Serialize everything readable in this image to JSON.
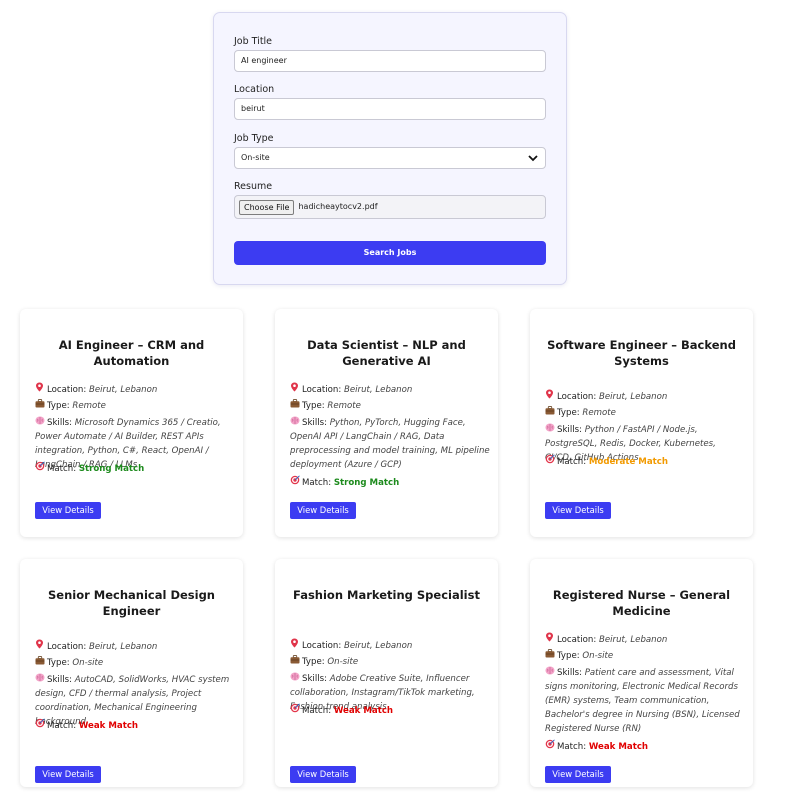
{
  "form": {
    "job_title_label": "Job Title",
    "job_title_value": "AI engineer",
    "location_label": "Location",
    "location_value": "beirut",
    "job_type_label": "Job Type",
    "job_type_value": "On-site",
    "resume_label": "Resume",
    "choose_file_label": "Choose File",
    "resume_file": "hadicheaytocv2.pdf",
    "search_label": "Search Jobs"
  },
  "labels": {
    "location": "Location:",
    "type": "Type:",
    "skills": "Skills:",
    "match": "Match:",
    "view_details": "View Details"
  },
  "icons": {
    "location": "pin-icon",
    "type": "briefcase-icon",
    "skills": "brain-icon",
    "match": "target-icon"
  },
  "colors": {
    "accent": "#3c3cf2",
    "strong": "#1c8a1c",
    "moderate": "#f29a00",
    "weak": "#e00000"
  },
  "jobs": [
    {
      "title": "AI Engineer – CRM and Automation",
      "location": "Beirut, Lebanon",
      "type": "Remote",
      "skills": "Microsoft Dynamics 365 / Creatio, Power Automate / AI Builder, REST APIs integration, Python, C#, React, OpenAI / LangChain / RAG / LLMs",
      "match": "Strong Match"
    },
    {
      "title": "Data Scientist – NLP and Generative AI",
      "location": "Beirut, Lebanon",
      "type": "Remote",
      "skills": "Python, PyTorch, Hugging Face, OpenAI API / LangChain / RAG, Data preprocessing and model training, ML pipeline deployment (Azure / GCP)",
      "match": "Strong Match"
    },
    {
      "title": "Software Engineer – Backend Systems",
      "location": "Beirut, Lebanon",
      "type": "Remote",
      "skills": "Python / FastAPI / Node.js, PostgreSQL, Redis, Docker, Kubernetes, CI/CD, GitHub Actions",
      "match": "Moderate Match"
    },
    {
      "title": "Senior Mechanical Design Engineer",
      "location": "Beirut, Lebanon",
      "type": "On-site",
      "skills": "AutoCAD, SolidWorks, HVAC system design, CFD / thermal analysis, Project coordination, Mechanical Engineering background",
      "match": "Weak Match"
    },
    {
      "title": "Fashion Marketing Specialist",
      "location": "Beirut, Lebanon",
      "type": "On-site",
      "skills": "Adobe Creative Suite, Influencer collaboration, Instagram/TikTok marketing, Fashion trend analysis",
      "match": "Weak Match"
    },
    {
      "title": "Registered Nurse – General Medicine",
      "location": "Beirut, Lebanon",
      "type": "On-site",
      "skills": "Patient care and assessment, Vital signs monitoring, Electronic Medical Records (EMR) systems, Team communication, Bachelor's degree in Nursing (BSN), Licensed Registered Nurse (RN)",
      "match": "Weak Match"
    }
  ]
}
